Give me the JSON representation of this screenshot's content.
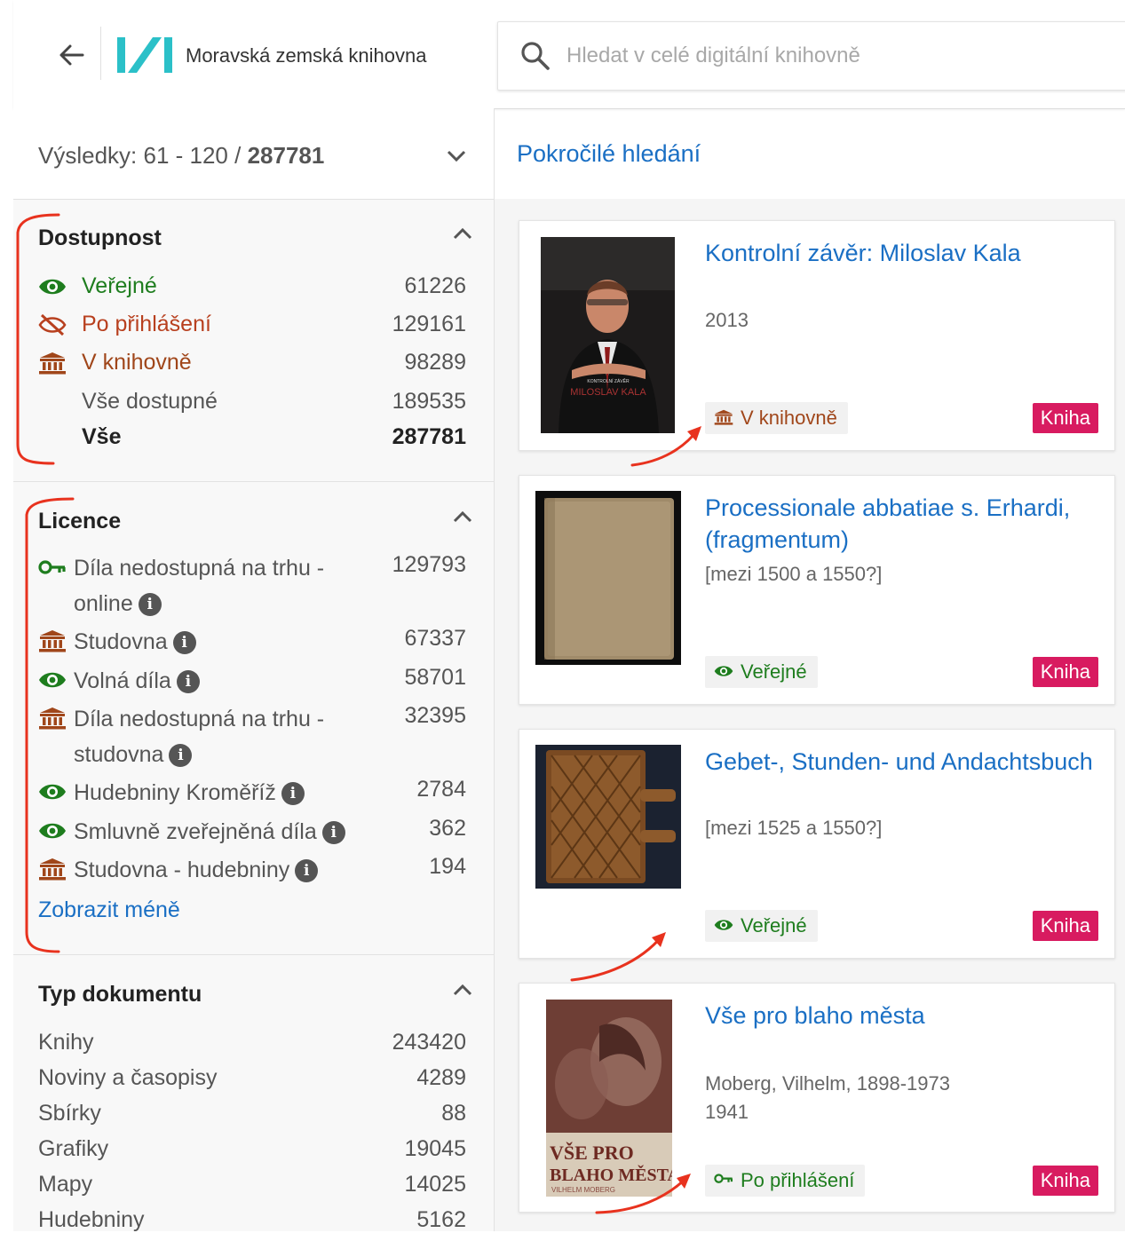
{
  "header": {
    "back_icon": "arrow-left-icon",
    "library_name": "Moravská zemská knihovna",
    "search_placeholder": "Hledat v celé digitální knihovně",
    "logo_color": "#2bc0c8"
  },
  "results": {
    "prefix": "Výsledky: 61 - 120 / ",
    "total": "287781"
  },
  "advanced_search_label": "Pokročilé hledání",
  "colors": {
    "public": "#1e7d1e",
    "login": "#b8401f",
    "library": "#a0461a",
    "link": "#1a6fc4",
    "badge": "#d81b60"
  },
  "facets": {
    "dostupnost": {
      "title": "Dostupnost",
      "items": [
        {
          "label": "Veřejné",
          "count": "61226",
          "icon": "eye-icon"
        },
        {
          "label": "Po přihlášení",
          "count": "129161",
          "icon": "eye-slash-icon"
        },
        {
          "label": "V knihovně",
          "count": "98289",
          "icon": "library-icon"
        },
        {
          "label": "Vše dostupné",
          "count": "189535",
          "icon": ""
        },
        {
          "label": "Vše",
          "count": "287781",
          "icon": ""
        }
      ]
    },
    "licence": {
      "title": "Licence",
      "items": [
        {
          "label_1": "Díla nedostupná na trhu -",
          "label_2": "online",
          "count": "129793",
          "icon": "key-icon"
        },
        {
          "label_1": "Studovna",
          "count": "67337",
          "icon": "library-icon"
        },
        {
          "label_1": "Volná díla",
          "count": "58701",
          "icon": "eye-icon"
        },
        {
          "label_1": "Díla nedostupná na trhu -",
          "label_2": "studovna",
          "count": "32395",
          "icon": "library-icon"
        },
        {
          "label_1": "Hudebniny Kroměříž",
          "count": "2784",
          "icon": "eye-icon"
        },
        {
          "label_1": "Smluvně zveřejněná díla",
          "count": "362",
          "icon": "eye-icon"
        },
        {
          "label_1": "Studovna - hudebniny",
          "count": "194",
          "icon": "library-icon"
        }
      ],
      "show_less": "Zobrazit méně"
    },
    "typ": {
      "title": "Typ dokumentu",
      "items": [
        {
          "label": "Knihy",
          "count": "243420"
        },
        {
          "label": "Noviny a časopisy",
          "count": "4289"
        },
        {
          "label": "Sbírky",
          "count": "88"
        },
        {
          "label": "Grafiky",
          "count": "19045"
        },
        {
          "label": "Mapy",
          "count": "14025"
        },
        {
          "label": "Hudebniny",
          "count": "5162"
        }
      ]
    }
  },
  "cards": [
    {
      "title": "Kontrolní závěr: Miloslav Kala",
      "meta_1": "2013",
      "meta_2": "",
      "access": "V knihovně",
      "access_icon": "library-icon",
      "kind": "Kniha",
      "cover_text_1": "KONTROLNÍ ZÁVĚR",
      "cover_text_2": "MILOSLAV KALA"
    },
    {
      "title": "Processionale abbatiae s. Erhardi, (fragmentum)",
      "meta_1": "[mezi 1500 a 1550?]",
      "meta_2": "",
      "access": "Veřejné",
      "access_icon": "eye-icon",
      "kind": "Kniha"
    },
    {
      "title": "Gebet-, Stunden- und Andachtsbuch",
      "meta_1": "[mezi 1525 a 1550?]",
      "meta_2": "",
      "access": "Veřejné",
      "access_icon": "eye-icon",
      "kind": "Kniha"
    },
    {
      "title": "Vše pro blaho města",
      "meta_1": "Moberg, Vilhelm, 1898-1973",
      "meta_2": "1941",
      "access": "Po přihlášení",
      "access_icon": "key-icon",
      "kind": "Kniha",
      "cover_text_1": "VŠE PRO",
      "cover_text_2": "BLAHO MĚSTA",
      "cover_text_3": "VILHELM MOBERG"
    }
  ]
}
